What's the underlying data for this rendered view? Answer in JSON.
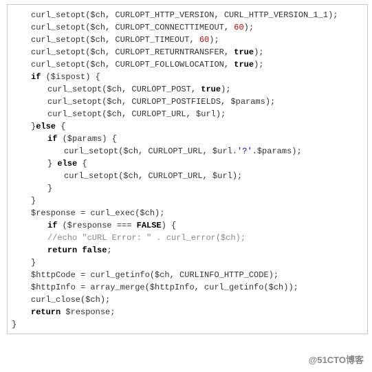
{
  "watermark": "@51CTO博客",
  "lines": [
    {
      "cls": "ind1",
      "segs": [
        "curl_setopt($ch, CURLOPT_HTTP_VERSION, CURL_HTTP_VERSION_1_1);"
      ]
    },
    {
      "cls": "ind1",
      "segs": [
        "curl_setopt($ch, CURLOPT_CONNECTTIMEOUT, ",
        {
          "t": "60",
          "c": "num"
        },
        ");"
      ]
    },
    {
      "cls": "ind1",
      "segs": [
        "curl_setopt($ch, CURLOPT_TIMEOUT, ",
        {
          "t": "60",
          "c": "num"
        },
        ");"
      ]
    },
    {
      "cls": "ind1",
      "segs": [
        "curl_setopt($ch, CURLOPT_RETURNTRANSFER, ",
        {
          "t": "true",
          "c": "kw"
        },
        ");"
      ]
    },
    {
      "cls": "ind1",
      "segs": [
        "curl_setopt($ch, CURLOPT_FOLLOWLOCATION, ",
        {
          "t": "true",
          "c": "kw"
        },
        ");"
      ]
    },
    {
      "cls": "ind1",
      "segs": [
        {
          "t": "if",
          "c": "kw"
        },
        " ($ispost) {"
      ]
    },
    {
      "cls": "ind2",
      "segs": [
        "curl_setopt($ch, CURLOPT_POST, ",
        {
          "t": "true",
          "c": "kw"
        },
        ");"
      ]
    },
    {
      "cls": "ind2",
      "segs": [
        "curl_setopt($ch, CURLOPT_POSTFIELDS, $params);"
      ]
    },
    {
      "cls": "ind2",
      "segs": [
        "curl_setopt($ch, CURLOPT_URL, $url);"
      ]
    },
    {
      "cls": "ind1",
      "segs": [
        "}",
        {
          "t": "else",
          "c": "kw"
        },
        " {"
      ]
    },
    {
      "cls": "ind2",
      "segs": [
        {
          "t": "if",
          "c": "kw"
        },
        " ($params) {"
      ]
    },
    {
      "cls": "ind3",
      "segs": [
        "curl_setopt($ch, CURLOPT_URL, $url.",
        {
          "t": "'?'",
          "c": "str"
        },
        ".$params);"
      ]
    },
    {
      "cls": "ind2",
      "segs": [
        "} ",
        {
          "t": "else",
          "c": "kw"
        },
        " {"
      ]
    },
    {
      "cls": "ind3",
      "segs": [
        "curl_setopt($ch, CURLOPT_URL, $url);"
      ]
    },
    {
      "cls": "ind2",
      "segs": [
        "}"
      ]
    },
    {
      "cls": "ind1",
      "segs": [
        "}"
      ]
    },
    {
      "cls": "ind1",
      "segs": [
        ""
      ]
    },
    {
      "cls": "ind1",
      "segs": [
        "$response = curl_exec($ch);"
      ]
    },
    {
      "cls": "ind2",
      "segs": [
        {
          "t": "if",
          "c": "kw"
        },
        " ($response === ",
        {
          "t": "FALSE",
          "c": "kw"
        },
        ") {"
      ]
    },
    {
      "cls": "ind2",
      "segs": [
        {
          "t": "//echo \"cURL Error: \" . curl_error($ch);",
          "c": "cmt"
        }
      ]
    },
    {
      "cls": "ind2",
      "segs": [
        {
          "t": "return",
          "c": "kw"
        },
        " ",
        {
          "t": "false",
          "c": "kw"
        },
        ";"
      ]
    },
    {
      "cls": "ind1",
      "segs": [
        "}"
      ]
    },
    {
      "cls": "ind1",
      "segs": [
        ""
      ]
    },
    {
      "cls": "ind1",
      "segs": [
        "$httpCode = curl_getinfo($ch, CURLINFO_HTTP_CODE);"
      ]
    },
    {
      "cls": "ind1",
      "segs": [
        "$httpInfo = array_merge($httpInfo, curl_getinfo($ch));"
      ]
    },
    {
      "cls": "ind1",
      "segs": [
        "curl_close($ch);"
      ]
    },
    {
      "cls": "ind1",
      "segs": [
        {
          "t": "return",
          "c": "kw"
        },
        " $response;"
      ]
    },
    {
      "cls": "",
      "segs": [
        "}"
      ]
    }
  ]
}
